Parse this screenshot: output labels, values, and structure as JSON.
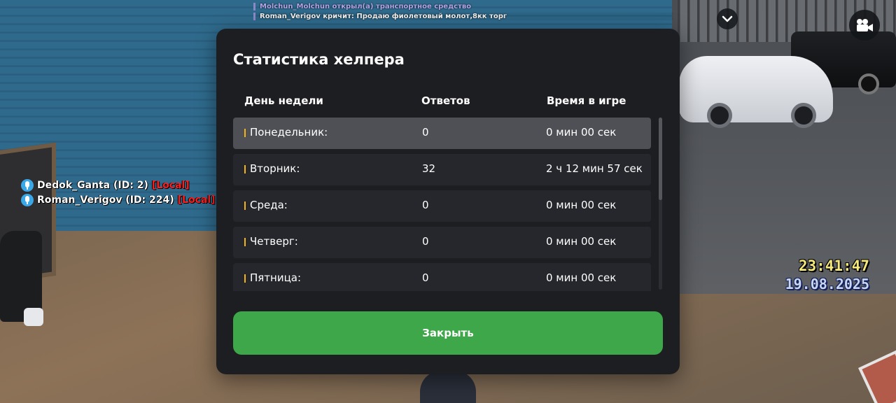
{
  "chat": {
    "lines": [
      "Molchun_Molchun открыл(а) транспортное средство",
      "Roman_Verigov кричит: Продаю фиолетовый молот,8кк торг"
    ]
  },
  "nametags": [
    {
      "name": "Dedok_Ganta (ID: 2)",
      "badge": "[Local]"
    },
    {
      "name": "Roman_Verigov (ID: 224)",
      "badge": "[Local]"
    }
  ],
  "clock": {
    "time": "23:41:47",
    "date": "19.08.2025"
  },
  "controls": {
    "chevron_icon": "chevron-down-icon",
    "camera_icon": "video-camera-icon"
  },
  "modal": {
    "title": "Статистика хелпера",
    "columns": {
      "day": "День недели",
      "answers": "Ответов",
      "time": "Время в игре"
    },
    "rows": [
      {
        "day": "Понедельник:",
        "answers": "0",
        "time": "0 мин 00 сек"
      },
      {
        "day": "Вторник:",
        "answers": "32",
        "time": "2 ч 12 мин 57 сек"
      },
      {
        "day": "Среда:",
        "answers": "0",
        "time": "0 мин 00 сек"
      },
      {
        "day": "Четверг:",
        "answers": "0",
        "time": "0 мин 00 сек"
      },
      {
        "day": "Пятница:",
        "answers": "0",
        "time": "0 мин 00 сек"
      }
    ],
    "close_label": "Закрыть",
    "accent_color": "#f2b418",
    "button_color": "#3ea74a"
  }
}
